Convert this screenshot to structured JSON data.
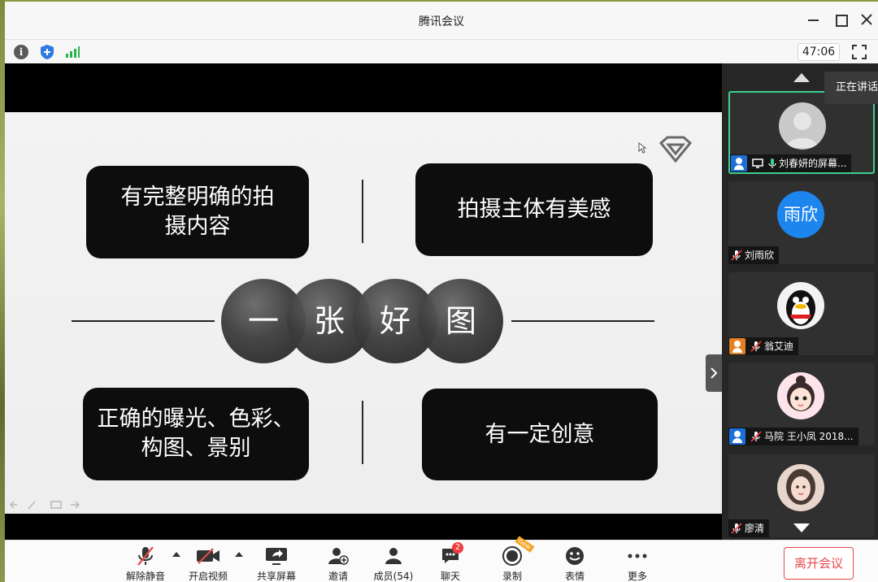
{
  "window": {
    "title": "腾讯会议"
  },
  "infobar": {
    "timer": "47:06"
  },
  "slide": {
    "card_1": "有完整明确的拍\n摄内容",
    "card_2": "拍摄主体有美感",
    "card_3": "正确的曝光、色彩、\n构图、景别",
    "card_4": "有一定创意",
    "orbs": [
      "一",
      "张",
      "好",
      "图"
    ]
  },
  "participants": {
    "speaking_tip": "正在讲话",
    "tiles": [
      {
        "name": "刘春妍的屏幕...",
        "avatar_text": ""
      },
      {
        "name": "刘雨欣",
        "avatar_text": "雨欣"
      },
      {
        "name": "翁艾迪",
        "avatar_text": ""
      },
      {
        "name": "马院 王小凤 2018...",
        "avatar_text": ""
      },
      {
        "name": "廖清",
        "avatar_text": ""
      }
    ]
  },
  "toolbar": {
    "unmute": "解除静音",
    "video": "开启视频",
    "share": "共享屏幕",
    "invite": "邀请",
    "members": "成员(54)",
    "chat": "聊天",
    "chat_badge": "2",
    "record": "录制",
    "record_tag": "new",
    "emoji": "表情",
    "more": "更多",
    "leave": "离开会议"
  },
  "colors": {
    "accent_green": "#3fcf8e",
    "leave_red": "#e64a4a",
    "host_blue": "#1c6ed8"
  }
}
